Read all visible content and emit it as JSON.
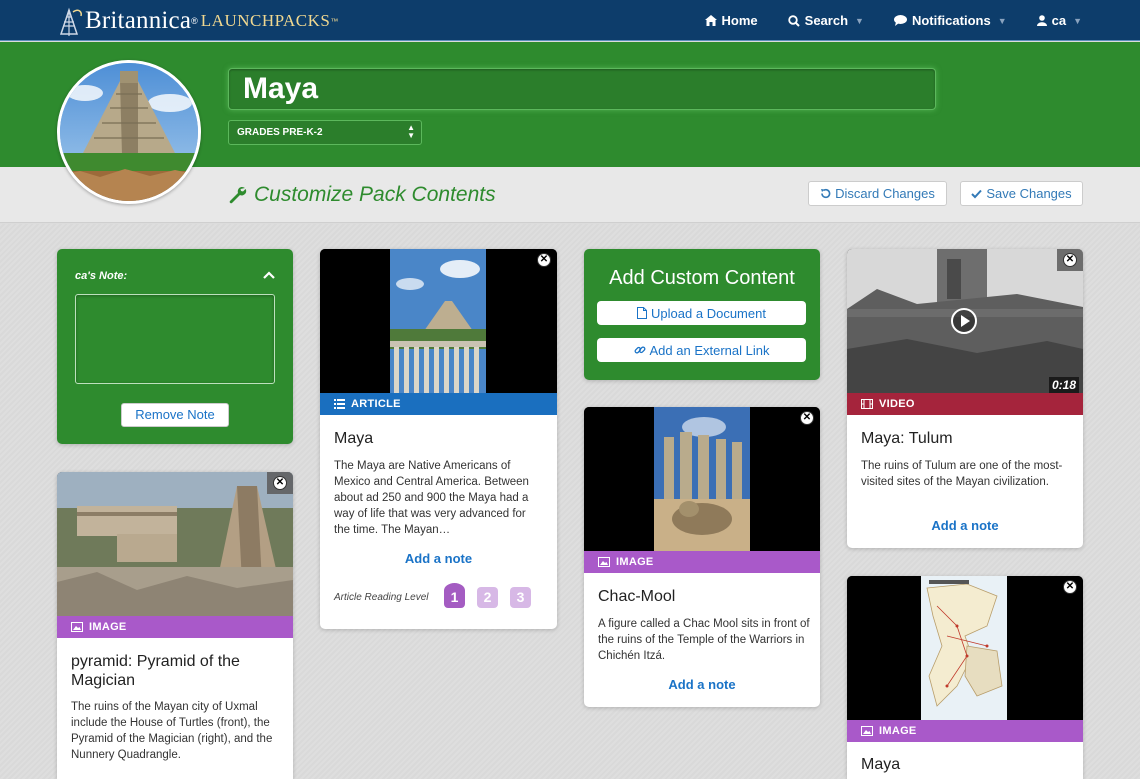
{
  "brand": {
    "name": "Britannica",
    "product": "LaunchPacks",
    "reg": "®",
    "tm": "™"
  },
  "nav": {
    "home": "Home",
    "search": "Search",
    "notifications": "Notifications",
    "user": "ca"
  },
  "pack": {
    "title": "Maya",
    "grade": "GRADES PRE-K-2"
  },
  "customize": {
    "heading": "Customize Pack Contents",
    "discard": "Discard Changes",
    "save": "Save Changes"
  },
  "note_card": {
    "label": "ca's Note:",
    "value": "",
    "remove": "Remove Note"
  },
  "add_custom": {
    "title": "Add Custom Content",
    "upload": "Upload a Document",
    "external": "Add an External Link"
  },
  "cards": {
    "maya_article": {
      "type": "ARTICLE",
      "title": "Maya",
      "desc": "The Maya are Native Americans of Mexico and Central America. Between about ad 250 and 900 the Maya had a way of life that was very advanced for the time. The Mayan…",
      "add_note": "Add a note",
      "level_label": "Article Reading Level",
      "levels": [
        "1",
        "2",
        "3"
      ],
      "active_level": "1"
    },
    "pyramid": {
      "type": "IMAGE",
      "title": "pyramid: Pyramid of the Magician",
      "desc": "The ruins of the Mayan city of Uxmal include the House of Turtles (front), the Pyramid of the Magician (right), and the Nunnery Quadrangle."
    },
    "chac_mool": {
      "type": "IMAGE",
      "title": "Chac-Mool",
      "desc": "A figure called a Chac Mool sits in front of the ruins of the Temple of the Warriors in Chichén Itzá.",
      "add_note": "Add a note"
    },
    "tulum": {
      "type": "VIDEO",
      "duration": "0:18",
      "title": "Maya: Tulum",
      "desc": "The ruins of Tulum are one of the most-visited sites of the Mayan civilization.",
      "add_note": "Add a note"
    },
    "maya_map": {
      "type": "IMAGE",
      "title": "Maya"
    }
  },
  "colors": {
    "nav": "#0d3d6b",
    "green": "#2e8b2e",
    "article": "#1a6fbf",
    "image": "#a959c9",
    "video": "#a5243c",
    "link": "#1a73c7"
  }
}
